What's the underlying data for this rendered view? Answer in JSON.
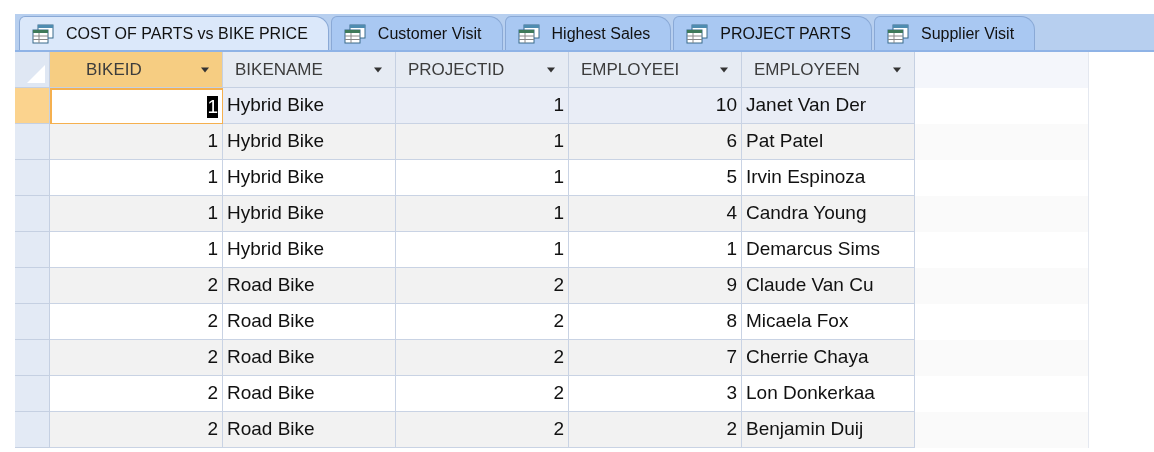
{
  "tabs": [
    {
      "label": "COST OF PARTS vs BIKE PRICE",
      "selected": true
    },
    {
      "label": "Customer Visit",
      "selected": false
    },
    {
      "label": "Highest Sales",
      "selected": false
    },
    {
      "label": "PROJECT PARTS",
      "selected": false
    },
    {
      "label": "Supplier Visit",
      "selected": false
    }
  ],
  "table": {
    "columns": [
      {
        "label": "BIKEID",
        "sorted": true
      },
      {
        "label": "BIKENAME",
        "sorted": false
      },
      {
        "label": "PROJECTID",
        "sorted": false
      },
      {
        "label": "EMPLOYEEI",
        "sorted": false
      },
      {
        "label": "EMPLOYEEN",
        "sorted": false
      }
    ],
    "rows": [
      {
        "selected": true,
        "cells": [
          "1",
          "Hybrid Bike",
          "1",
          "10",
          "Janet Van Der"
        ]
      },
      {
        "selected": false,
        "cells": [
          "1",
          "Hybrid Bike",
          "1",
          "6",
          "Pat Patel"
        ]
      },
      {
        "selected": false,
        "cells": [
          "1",
          "Hybrid Bike",
          "1",
          "5",
          "Irvin Espinoza"
        ]
      },
      {
        "selected": false,
        "cells": [
          "1",
          "Hybrid Bike",
          "1",
          "4",
          "Candra Young"
        ]
      },
      {
        "selected": false,
        "cells": [
          "1",
          "Hybrid Bike",
          "1",
          "1",
          "Demarcus Sims"
        ]
      },
      {
        "selected": false,
        "cells": [
          "2",
          "Road Bike",
          "2",
          "9",
          "Claude Van Cu"
        ]
      },
      {
        "selected": false,
        "cells": [
          "2",
          "Road Bike",
          "2",
          "8",
          "Micaela Fox"
        ]
      },
      {
        "selected": false,
        "cells": [
          "2",
          "Road Bike",
          "2",
          "7",
          "Cherrie Chaya"
        ]
      },
      {
        "selected": false,
        "cells": [
          "2",
          "Road Bike",
          "2",
          "3",
          "Lon Donkerkaa"
        ]
      },
      {
        "selected": false,
        "cells": [
          "2",
          "Road Bike",
          "2",
          "2",
          "Benjamin Duij"
        ]
      }
    ]
  }
}
